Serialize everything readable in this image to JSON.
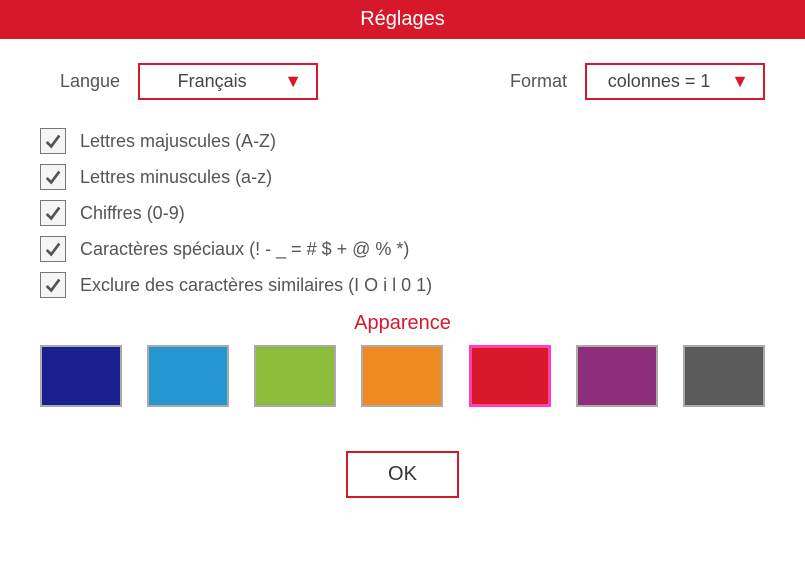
{
  "title": "Réglages",
  "langue": {
    "label": "Langue",
    "value": "Français"
  },
  "format": {
    "label": "Format",
    "value": "colonnes = 1"
  },
  "options": [
    {
      "label": "Lettres majuscules (A-Z)",
      "checked": true
    },
    {
      "label": "Lettres minuscules (a-z)",
      "checked": true
    },
    {
      "label": "Chiffres (0-9)",
      "checked": true
    },
    {
      "label": "Caractères spéciaux (! - _ = # $ + @ % *)",
      "checked": true
    },
    {
      "label": "Exclure des caractères similaires  (I O i l 0 1)",
      "checked": true
    }
  ],
  "apparence_label": "Apparence",
  "colors": [
    {
      "hex": "#1a1f8f",
      "selected": false
    },
    {
      "hex": "#2496d1",
      "selected": false
    },
    {
      "hex": "#8bbd3a",
      "selected": false
    },
    {
      "hex": "#ef8a21",
      "selected": false
    },
    {
      "hex": "#d7182a",
      "selected": true
    },
    {
      "hex": "#8e2d7a",
      "selected": false
    },
    {
      "hex": "#5a5a5a",
      "selected": false
    }
  ],
  "ok_label": "OK"
}
